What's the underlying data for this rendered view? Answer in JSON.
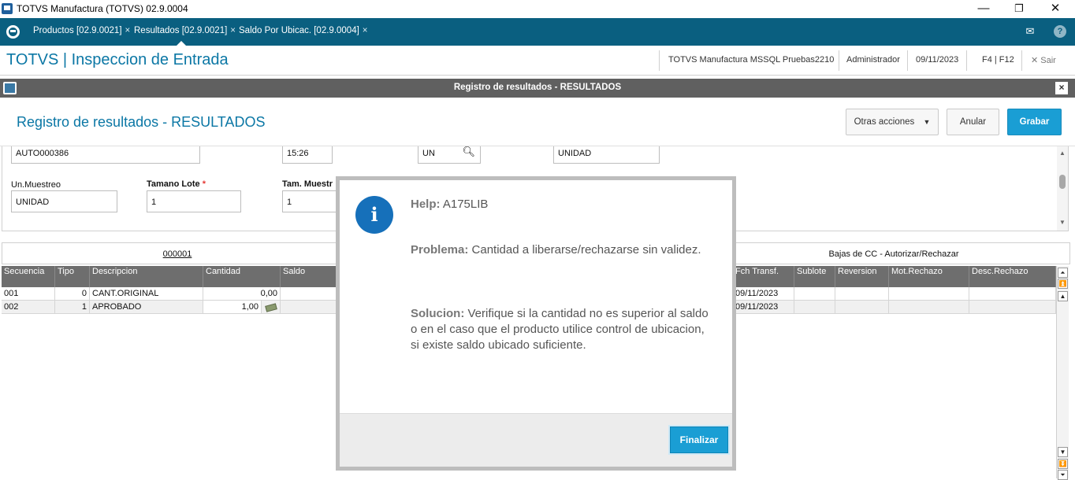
{
  "window": {
    "title": "TOTVS Manufactura (TOTVS) 02.9.0004",
    "minimize": "—",
    "restore": "❐",
    "close": "✕"
  },
  "tabs": [
    {
      "label": "Productos [02.9.0021]",
      "close": "×"
    },
    {
      "label": "Resultados [02.9.0021]",
      "close": "×"
    },
    {
      "label": "Saldo Por Ubicac. [02.9.0004]",
      "close": "×"
    }
  ],
  "topbar": {
    "mail_icon": "✉",
    "help_icon": "?"
  },
  "app": {
    "title": "TOTVS | Inspeccion de Entrada",
    "environment": "TOTVS Manufactura MSSQL Pruebas2210",
    "user": "Administrador",
    "date": "09/11/2023",
    "shortcuts": "F4 | F12",
    "exit_icon": "✕",
    "exit_label": "Sair"
  },
  "dialog": {
    "bar_title": "Registro de resultados - RESULTADOS",
    "close": "×",
    "form_title": "Registro de resultados - RESULTADOS",
    "buttons": {
      "other_actions": "Otras acciones",
      "other_actions_caret": "▼",
      "cancel": "Anular",
      "save": "Grabar"
    }
  },
  "form": {
    "row1": {
      "field1": "AUTO000386",
      "field2": "15:26",
      "field3": "UN",
      "field4": "UNIDAD"
    },
    "row2": {
      "label1": "Un.Muestreo",
      "value1": "UNIDAD",
      "label2": "Tamano Lote",
      "required": "*",
      "value2": "1",
      "label3": "Tam. Muestr",
      "value3": "1"
    }
  },
  "folders": {
    "left": "000001",
    "right": "Bajas de CC - Autorizar/Rechazar"
  },
  "grid": {
    "headers": {
      "secuencia": "Secuencia",
      "tipo": "Tipo",
      "descripcion": "Descripcion",
      "cantidad": "Cantidad",
      "saldo": "Saldo",
      "fch_transf": "Fch Transf.",
      "sublote": "Sublote",
      "reversion": "Reversion",
      "mot_rechazo": "Mot.Rechazo",
      "desc_rechazo": "Desc.Rechazo"
    },
    "rows": [
      {
        "secuencia": "001",
        "tipo": "0",
        "descripcion": "CANT.ORIGINAL",
        "cantidad": "0,00",
        "fch_transf": "09/11/2023"
      },
      {
        "secuencia": "002",
        "tipo": "1",
        "descripcion": "APROBADO",
        "cantidad": "1,00",
        "fch_transf": "09/11/2023"
      }
    ]
  },
  "help_modal": {
    "help_label": "Help:",
    "help_code": "A175LIB",
    "problem_label": "Problema:",
    "problem_text": "Cantidad a liberarse/rechazarse sin validez.",
    "solution_label": "Solucion:",
    "solution_text": "Verifique si la cantidad no es superior al saldo o en el caso que el producto utilice control de ubicacion, si existe saldo ubicado suficiente.",
    "info_icon": "i",
    "button": "Finalizar"
  },
  "colors": {
    "tabbar": "#0a5f80",
    "accent": "#0b77a5",
    "primary_button": "#1a9ed4",
    "info_icon": "#1670ba",
    "grid_header": "#6e6e6e"
  }
}
